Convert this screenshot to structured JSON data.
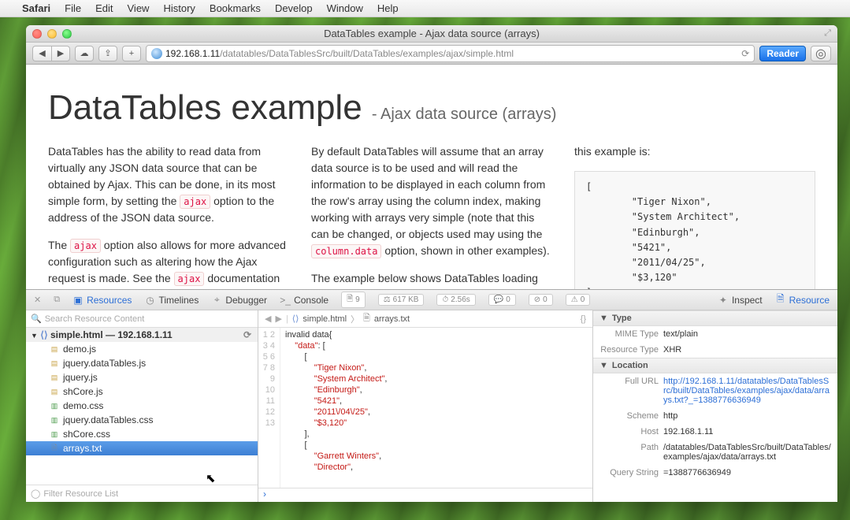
{
  "menubar": {
    "app": "Safari",
    "items": [
      "File",
      "Edit",
      "View",
      "History",
      "Bookmarks",
      "Develop",
      "Window",
      "Help"
    ]
  },
  "window": {
    "title": "DataTables example - Ajax data source (arrays)",
    "url_host": "192.168.1.11",
    "url_path": "/datatables/DataTablesSrc/built/DataTables/examples/ajax/simple.html",
    "reader_label": "Reader"
  },
  "page": {
    "h1": "DataTables example",
    "h1_sub": "- Ajax data source (arrays)",
    "col1_p1a": "DataTables has the ability to read data from virtually any JSON data source that can be obtained by Ajax. This can be done, in its most simple form, by setting the ",
    "col1_p1_code": "ajax",
    "col1_p1b": " option to the address of the JSON data source.",
    "col1_p2a": "The ",
    "col1_p2_code1": "ajax",
    "col1_p2b": " option also allows for more advanced configuration such as altering how the Ajax request is made. See the ",
    "col1_p2_code2": "ajax",
    "col1_p2c": " documentation or the other Ajax examples for DataTables for further",
    "col2_p1a": "By default DataTables will assume that an array data source is to be used and will read the information to be displayed in each column from the row's array using the column index, making working with arrays very simple (note that this can be changed, or objects used may using the ",
    "col2_p1_code": "column.data",
    "col2_p1b": " option, shown in other examples).",
    "col2_p2": "The example below shows DataTables loading data for a table from arrays as the data source,",
    "col3_label": "this example is:",
    "sample": "[\n        \"Tiger Nixon\",\n        \"System Architect\",\n        \"Edinburgh\",\n        \"5421\",\n        \"2011/04/25\",\n        \"$3,120\"\n]"
  },
  "devtools": {
    "tabs": {
      "resources": "Resources",
      "timelines": "Timelines",
      "debugger": "Debugger",
      "console": "Console",
      "inspect": "Inspect",
      "resource": "Resource"
    },
    "stats": {
      "requests": "9",
      "size": "617 KB",
      "time": "2.56s",
      "logs": "0",
      "errors": "0",
      "warnings": "0"
    },
    "search_placeholder": "Search Resource Content",
    "filter_placeholder": "Filter Resource List",
    "tree_root": "simple.html — 192.168.1.11",
    "files": [
      {
        "name": "demo.js",
        "type": "js"
      },
      {
        "name": "jquery.dataTables.js",
        "type": "js"
      },
      {
        "name": "jquery.js",
        "type": "js"
      },
      {
        "name": "shCore.js",
        "type": "js"
      },
      {
        "name": "demo.css",
        "type": "css"
      },
      {
        "name": "jquery.dataTables.css",
        "type": "css"
      },
      {
        "name": "shCore.css",
        "type": "css"
      },
      {
        "name": "arrays.txt",
        "type": "doc",
        "selected": true
      }
    ],
    "crumb": {
      "a": "simple.html",
      "b": "arrays.txt"
    },
    "code": "invalid data{\n    \"data\": [\n        [\n            \"Tiger Nixon\",\n            \"System Architect\",\n            \"Edinburgh\",\n            \"5421\",\n            \"2011\\/04\\/25\",\n            \"$3,120\"\n        ],\n        [\n            \"Garrett Winters\",\n            \"Director\",",
    "details": {
      "type_section": "Type",
      "mime_label": "MIME Type",
      "mime_value": "text/plain",
      "restype_label": "Resource Type",
      "restype_value": "XHR",
      "location_section": "Location",
      "fullurl_label": "Full URL",
      "fullurl_value": "http://192.168.1.11/datatables/DataTablesSrc/built/DataTables/examples/ajax/data/arrays.txt?_=1388776636949",
      "scheme_label": "Scheme",
      "scheme_value": "http",
      "host_label": "Host",
      "host_value": "192.168.1.11",
      "path_label": "Path",
      "path_value": "/datatables/DataTablesSrc/built/DataTables/examples/ajax/data/arrays.txt",
      "query_label": "Query String",
      "query_value": "=1388776636949"
    }
  }
}
